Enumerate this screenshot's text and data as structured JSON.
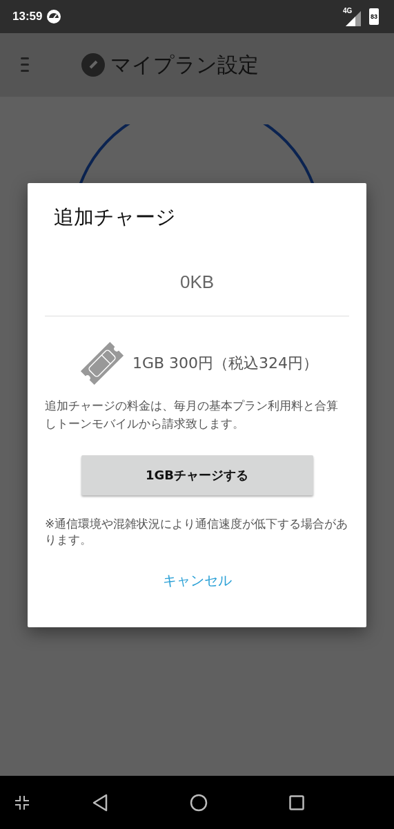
{
  "status_bar": {
    "time": "13:59",
    "network": "4G",
    "battery": "83"
  },
  "app_bar": {
    "title": "マイプラン設定"
  },
  "dialog": {
    "title": "追加チャージ",
    "remaining": "0KB",
    "price": "1GB 300円（税込324円）",
    "description": "追加チャージの料金は、毎月の基本プラン利用料と合算しトーンモバイルから請求致します。",
    "charge_button": "1GBチャージする",
    "note": "※通信環境や混雑状況により通信速度が低下する場合があります。",
    "cancel": "キャンセル"
  }
}
